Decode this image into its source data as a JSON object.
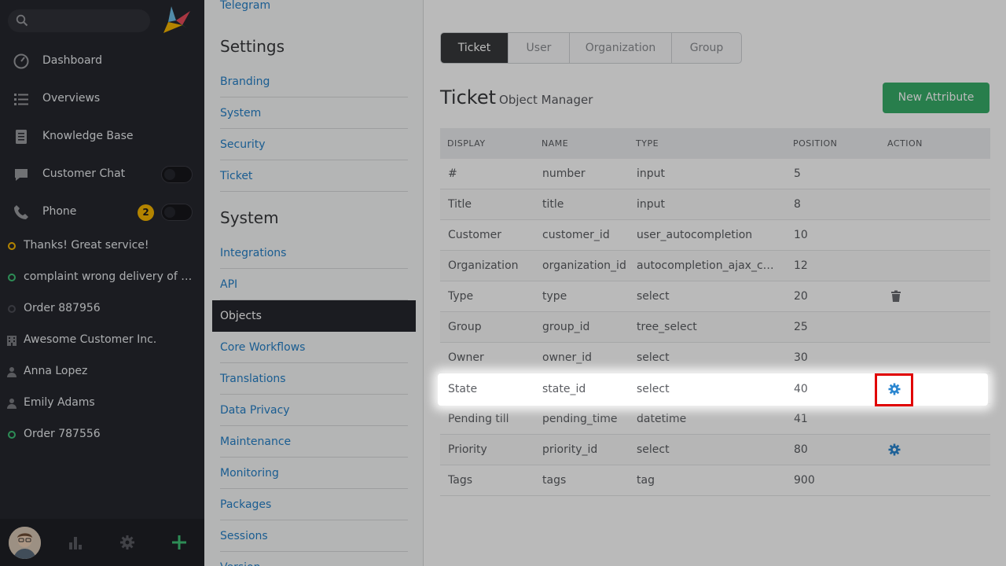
{
  "sidebar": {
    "search": {
      "placeholder": ""
    },
    "nav": [
      {
        "label": "Dashboard",
        "icon": "dashboard-icon"
      },
      {
        "label": "Overviews",
        "icon": "list-icon"
      },
      {
        "label": "Knowledge Base",
        "icon": "book-icon"
      },
      {
        "label": "Customer Chat",
        "icon": "chat-icon"
      },
      {
        "label": "Phone",
        "icon": "phone-icon",
        "badge": "2"
      }
    ],
    "tasks": [
      {
        "label": "Thanks! Great service!",
        "status": "yellow"
      },
      {
        "label": "complaint wrong delivery of order",
        "status": "green"
      },
      {
        "label": "Order 887956",
        "status": "grey"
      },
      {
        "label": "Awesome Customer Inc.",
        "icon": "building-icon"
      },
      {
        "label": "Anna Lopez",
        "icon": "person-icon"
      },
      {
        "label": "Emily Adams",
        "icon": "person-icon"
      },
      {
        "label": "Order 787556",
        "status": "green"
      }
    ]
  },
  "settings": {
    "top_link": "Telegram",
    "sections": [
      {
        "title": "Settings",
        "links": [
          "Branding",
          "System",
          "Security",
          "Ticket"
        ]
      },
      {
        "title": "System",
        "links": [
          "Integrations",
          "API",
          "Objects",
          "Core Workflows",
          "Translations",
          "Data Privacy",
          "Maintenance",
          "Monitoring",
          "Packages",
          "Sessions",
          "Version"
        ]
      }
    ],
    "active": "Objects"
  },
  "main": {
    "tabs": [
      "Ticket",
      "User",
      "Organization",
      "Group"
    ],
    "active_tab": "Ticket",
    "title": "Ticket",
    "subtitle": "Object Manager",
    "new_button": "New Attribute",
    "columns": [
      "DISPLAY",
      "NAME",
      "TYPE",
      "POSITION",
      "ACTION"
    ],
    "rows": [
      {
        "display": "#",
        "name": "number",
        "type": "input",
        "position": "5",
        "action": ""
      },
      {
        "display": "Title",
        "name": "title",
        "type": "input",
        "position": "8",
        "action": ""
      },
      {
        "display": "Customer",
        "name": "customer_id",
        "type": "user_autocompletion",
        "position": "10",
        "action": ""
      },
      {
        "display": "Organization",
        "name": "organization_id",
        "type": "autocompletion_ajax_customer_organization",
        "position": "12",
        "action": ""
      },
      {
        "display": "Type",
        "name": "type",
        "type": "select",
        "position": "20",
        "action": "trash-icon"
      },
      {
        "display": "Group",
        "name": "group_id",
        "type": "tree_select",
        "position": "25",
        "action": ""
      },
      {
        "display": "Owner",
        "name": "owner_id",
        "type": "select",
        "position": "30",
        "action": ""
      },
      {
        "display": "State",
        "name": "state_id",
        "type": "select",
        "position": "40",
        "action": "gear-icon"
      },
      {
        "display": "Pending till",
        "name": "pending_time",
        "type": "datetime",
        "position": "41",
        "action": ""
      },
      {
        "display": "Priority",
        "name": "priority_id",
        "type": "select",
        "position": "80",
        "action": "gear-icon"
      },
      {
        "display": "Tags",
        "name": "tags",
        "type": "tag",
        "position": "900",
        "action": ""
      }
    ]
  },
  "colors": {
    "accent": "#38ad69",
    "link": "#2580c7",
    "highlight": "#e00000",
    "sidebar": "#26272e"
  }
}
